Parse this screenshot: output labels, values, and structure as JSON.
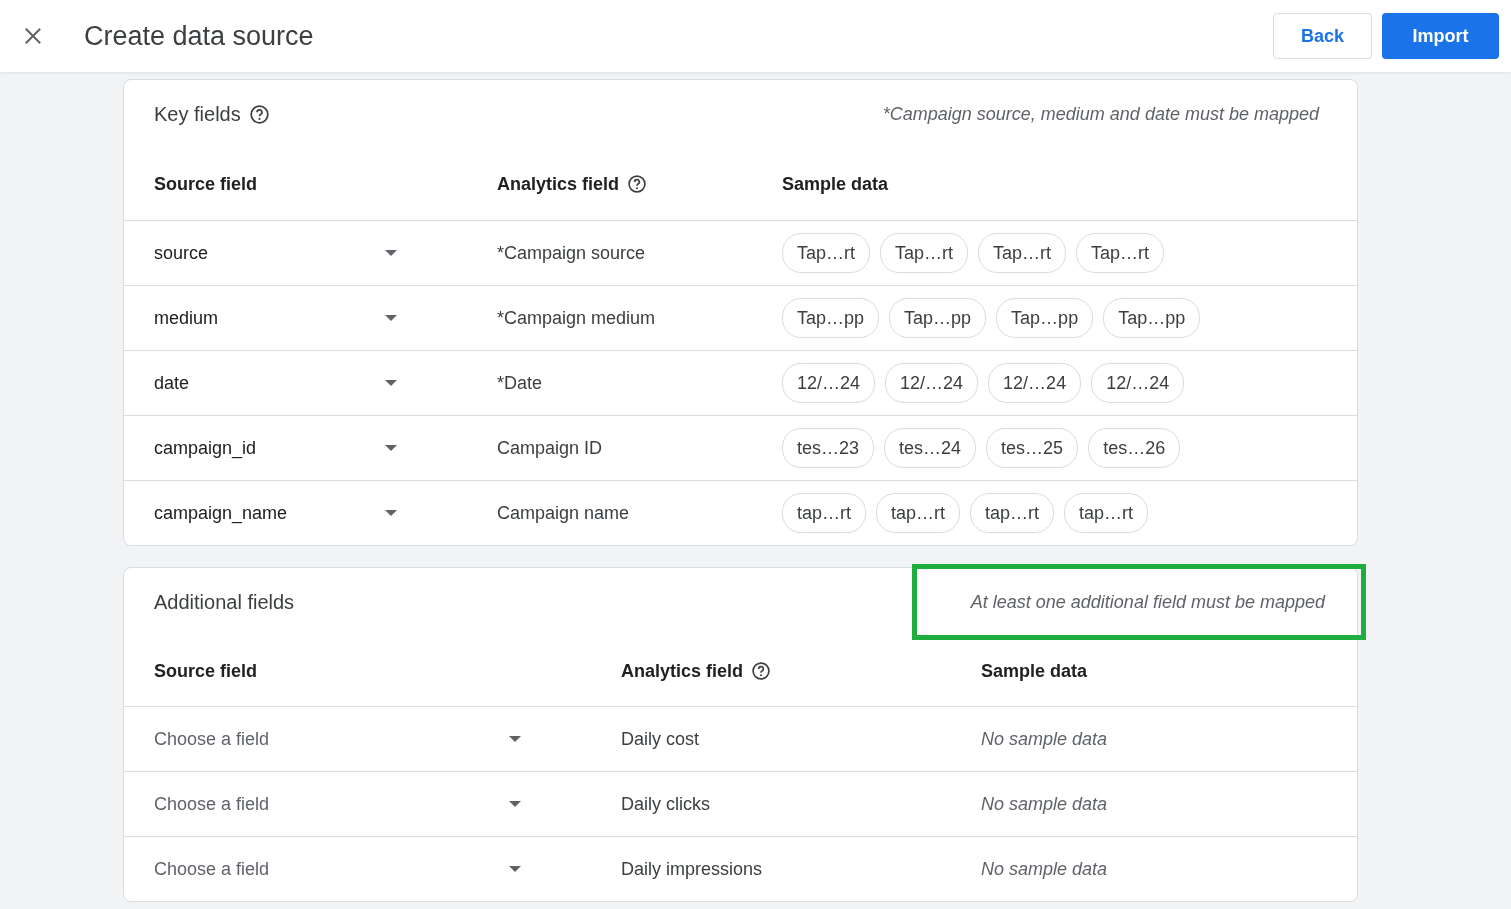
{
  "header": {
    "title": "Create data source",
    "buttons": [
      {
        "label": "Back",
        "kind": "outlined"
      },
      {
        "label": "Import",
        "kind": "filled"
      }
    ]
  },
  "key_fields": {
    "title": "Key fields",
    "note": "*Campaign source, medium and date must be mapped",
    "columns": [
      {
        "label": "Source field",
        "help": false
      },
      {
        "label": "Analytics field",
        "help": true
      },
      {
        "label": "Sample data",
        "help": false
      }
    ],
    "rows": [
      {
        "source_field": "source",
        "analytics_field": "*Campaign source",
        "samples": [
          "Tap…rt",
          "Tap…rt",
          "Tap…rt",
          "Tap…rt"
        ]
      },
      {
        "source_field": "medium",
        "analytics_field": "*Campaign medium",
        "samples": [
          "Tap…pp",
          "Tap…pp",
          "Tap…pp",
          "Tap…pp"
        ]
      },
      {
        "source_field": "date",
        "analytics_field": "*Date",
        "samples": [
          "12/…24",
          "12/…24",
          "12/…24",
          "12/…24"
        ]
      },
      {
        "source_field": "campaign_id",
        "analytics_field": "Campaign ID",
        "samples": [
          "tes…23",
          "tes…24",
          "tes…25",
          "tes…26"
        ]
      },
      {
        "source_field": "campaign_name",
        "analytics_field": "Campaign name",
        "samples": [
          "tap…rt",
          "tap…rt",
          "tap…rt",
          "tap…rt"
        ]
      }
    ]
  },
  "additional_fields": {
    "title": "Additional fields",
    "note": "At least one additional field must be mapped",
    "note_highlighted": true,
    "columns": [
      {
        "label": "Source field",
        "help": false
      },
      {
        "label": "Analytics field",
        "help": true
      },
      {
        "label": "Sample data",
        "help": false
      }
    ],
    "rows": [
      {
        "source_placeholder": "Choose a field",
        "analytics_field": "Daily cost",
        "sample_text": "No sample data"
      },
      {
        "source_placeholder": "Choose a field",
        "analytics_field": "Daily clicks",
        "sample_text": "No sample data"
      },
      {
        "source_placeholder": "Choose a field",
        "analytics_field": "Daily impressions",
        "sample_text": "No sample data"
      }
    ]
  }
}
